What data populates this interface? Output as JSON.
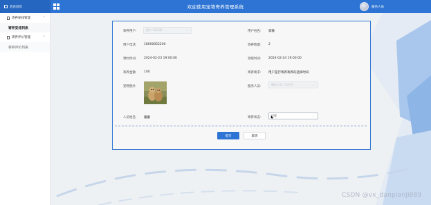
{
  "header": {
    "home_label": "后台首页",
    "title": "欢迎使用宠物寄养管理系统",
    "username": "服务人员"
  },
  "sidebar": {
    "groups": [
      {
        "label": "寄养安排管理",
        "items": [
          "寄养安排列表"
        ]
      },
      {
        "label": "寄养评价管理",
        "items": [
          "寄养评价列表"
        ]
      }
    ]
  },
  "form": {
    "fields": {
      "user_account": {
        "label": "寄养用户:",
        "value": "用户 133-02"
      },
      "user_name": {
        "label": "用户姓名:",
        "value": "郭静"
      },
      "user_phone": {
        "label": "用户电话:",
        "value": "18600052200"
      },
      "foster_count": {
        "label": "寄养数量:",
        "value": "2"
      },
      "foster_time": {
        "label": "预约时间:",
        "value": "2024-02-23 19:00:00"
      },
      "pickup_time": {
        "label": "领取时间:",
        "value": "2024-02-24 19:00:00"
      },
      "foster_amount": {
        "label": "寄养金额:",
        "value": "100"
      },
      "foster_requirement": {
        "label": "寄养要求:",
        "value": "用户是行寄养寄养的选择时间"
      },
      "pet_photo": {
        "label": "宠物图片:"
      },
      "service_staff": {
        "label": "服务人员:",
        "value": "服务人员 133-03"
      },
      "staff_name": {
        "label": "人员姓名:",
        "value": "蕾蕾"
      },
      "foster_status": {
        "label": "寄养状态:",
        "value": "已完"
      }
    },
    "buttons": {
      "submit": "提交",
      "cancel": "取消"
    }
  },
  "watermark": "CSDN @vx_danpianji889",
  "colors": {
    "primary": "#2d74d4",
    "sidebar_bg": "#ffffff",
    "content_bg": "#eef1f4"
  }
}
